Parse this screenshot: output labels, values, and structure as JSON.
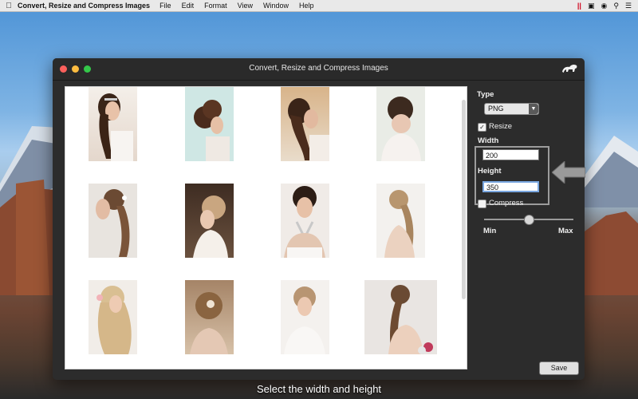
{
  "menubar": {
    "app_name": "Convert, Resize and Compress Images",
    "items": [
      "File",
      "Edit",
      "Format",
      "View",
      "Window",
      "Help"
    ]
  },
  "window": {
    "title": "Convert, Resize and Compress Images"
  },
  "panel": {
    "type_label": "Type",
    "type_value": "PNG",
    "resize_label": "Resize",
    "resize_checked": true,
    "width_label": "Width",
    "width_value": "200",
    "height_label": "Height",
    "height_value": "350",
    "compress_label": "Compress",
    "compress_checked": false,
    "slider_min_label": "Min",
    "slider_max_label": "Max",
    "slider_value": 0.5,
    "save_label": "Save"
  },
  "gallery": {
    "thumbnails": [
      {
        "name": "bride-hairstyle-1"
      },
      {
        "name": "bride-hairstyle-2"
      },
      {
        "name": "bride-hairstyle-3"
      },
      {
        "name": "bride-hairstyle-4"
      },
      {
        "name": "bride-hairstyle-5"
      },
      {
        "name": "bride-hairstyle-6"
      },
      {
        "name": "bride-hairstyle-7"
      },
      {
        "name": "bride-hairstyle-8"
      },
      {
        "name": "bride-hairstyle-9"
      },
      {
        "name": "bride-hairstyle-10"
      },
      {
        "name": "bride-hairstyle-11"
      },
      {
        "name": "bride-hairstyle-12"
      }
    ]
  },
  "caption": "Select the width and height",
  "colors": {
    "window_bg": "#2c2c2c",
    "close": "#fc605c",
    "minimize": "#fdbc40",
    "zoom": "#34c84a"
  }
}
